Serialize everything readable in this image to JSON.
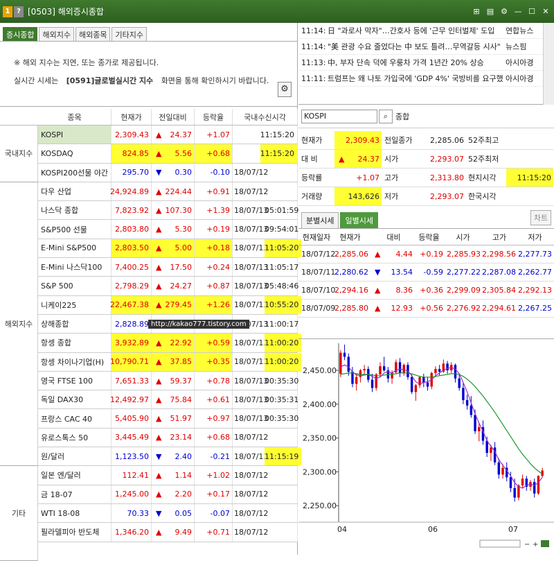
{
  "titlebar": {
    "num1": "1",
    "num2": "?",
    "title": "[0503] 해외증시종합"
  },
  "tabs": [
    "증시종합",
    "해외지수",
    "해외종목",
    "기타지수"
  ],
  "notice": {
    "line1": "※ 해외 지수는 지연, 또는 종가로 제공됩니다.",
    "line2_a": "실시간 시세는",
    "line2_b": "[0591]글로벌실시간 지수",
    "line2_c": "화면을 통해 확인하시기 바랍니다."
  },
  "table": {
    "headers": [
      "종목",
      "현재가",
      "전일대비",
      "등락율",
      "국내수신시각"
    ],
    "groups": [
      {
        "label": "국내지수",
        "rows": 3
      },
      {
        "label": "해외지수",
        "rows": 15
      },
      {
        "label": "기타",
        "rows": 5
      }
    ],
    "rows": [
      {
        "name": "KOSPI",
        "price": "2,309.43",
        "dir": "up",
        "chg": "24.37",
        "rate": "+1.07",
        "date": "",
        "time": "11:15:20",
        "hl": [
          "name"
        ],
        "hltime": false
      },
      {
        "name": "KOSDAQ",
        "price": "824.85",
        "dir": "up",
        "chg": "5.56",
        "rate": "+0.68",
        "date": "",
        "time": "11:15:20",
        "hl": [
          "price",
          "chg",
          "rate"
        ],
        "hltime": true
      },
      {
        "name": "KOSPI200선물 야간",
        "price": "295.70",
        "dir": "down",
        "chg": "0.30",
        "rate": "-0.10",
        "date": "18/07/12",
        "time": "",
        "hl": [],
        "hltime": false
      },
      {
        "name": "다우 산업",
        "price": "24,924.89",
        "dir": "up",
        "chg": "224.44",
        "rate": "+0.91",
        "date": "18/07/12",
        "time": "",
        "hl": [],
        "hltime": false
      },
      {
        "name": "나스닥 종합",
        "price": "7,823.92",
        "dir": "up",
        "chg": "107.30",
        "rate": "+1.39",
        "date": "18/07/13",
        "time": "05:01:59",
        "hl": [],
        "hltime": false
      },
      {
        "name": "S&P500 선물",
        "price": "2,803.80",
        "dir": "up",
        "chg": "5.30",
        "rate": "+0.19",
        "date": "18/07/13",
        "time": "09:54:01",
        "hl": [],
        "hltime": false
      },
      {
        "name": "E-Mini S&P500",
        "price": "2,803.50",
        "dir": "up",
        "chg": "5.00",
        "rate": "+0.18",
        "date": "18/07/13",
        "time": "11:05:20",
        "hl": [
          "price",
          "chg",
          "rate"
        ],
        "hltime": true
      },
      {
        "name": "E-Mini 나스닥100",
        "price": "7,400.25",
        "dir": "up",
        "chg": "17.50",
        "rate": "+0.24",
        "date": "18/07/13",
        "time": "11:05:17",
        "hl": [],
        "hltime": false
      },
      {
        "name": "S&P 500",
        "price": "2,798.29",
        "dir": "up",
        "chg": "24.27",
        "rate": "+0.87",
        "date": "18/07/13",
        "time": "05:48:46",
        "hl": [],
        "hltime": false
      },
      {
        "name": "니케이225",
        "price": "22,467.38",
        "dir": "up",
        "chg": "279.45",
        "rate": "+1.26",
        "date": "18/07/13",
        "time": "10:55:20",
        "hl": [
          "price",
          "chg",
          "rate"
        ],
        "hltime": true
      },
      {
        "name": "상해종합",
        "price": "2,828.89",
        "dir": "down",
        "chg": "8.77",
        "rate": "-0.31",
        "date": "18/07/13",
        "time": "11:00:17",
        "hl": [],
        "hltime": false
      },
      {
        "name": "항셍 종합",
        "price": "3,932.89",
        "dir": "up",
        "chg": "22.92",
        "rate": "+0.59",
        "date": "18/07/13",
        "time": "11:00:20",
        "hl": [
          "price",
          "chg",
          "rate"
        ],
        "hltime": true
      },
      {
        "name": "항셍 차이나기업(H)",
        "price": "10,790.71",
        "dir": "up",
        "chg": "37.85",
        "rate": "+0.35",
        "date": "18/07/13",
        "time": "11:00:20",
        "hl": [
          "price",
          "chg",
          "rate"
        ],
        "hltime": true
      },
      {
        "name": "영국 FTSE 100",
        "price": "7,651.33",
        "dir": "up",
        "chg": "59.37",
        "rate": "+0.78",
        "date": "18/07/13",
        "time": "00:35:30",
        "hl": [],
        "hltime": false
      },
      {
        "name": "독일 DAX30",
        "price": "12,492.97",
        "dir": "up",
        "chg": "75.84",
        "rate": "+0.61",
        "date": "18/07/13",
        "time": "00:35:31",
        "hl": [],
        "hltime": false
      },
      {
        "name": "프랑스 CAC 40",
        "price": "5,405.90",
        "dir": "up",
        "chg": "51.97",
        "rate": "+0.97",
        "date": "18/07/13",
        "time": "00:35:30",
        "hl": [],
        "hltime": false
      },
      {
        "name": "유로스톡스 50",
        "price": "3,445.49",
        "dir": "up",
        "chg": "23.14",
        "rate": "+0.68",
        "date": "18/07/12",
        "time": "",
        "hl": [],
        "hltime": false
      },
      {
        "name": "원/달러",
        "price": "1,123.50",
        "dir": "down",
        "chg": "2.40",
        "rate": "-0.21",
        "date": "18/07/13",
        "time": "11:15:19",
        "hl": [],
        "hltime": true
      },
      {
        "name": "일본 엔/달러",
        "price": "112.41",
        "dir": "up",
        "chg": "1.14",
        "rate": "+1.02",
        "date": "18/07/12",
        "time": "",
        "hl": [],
        "hltime": false
      },
      {
        "name": "금 18-07",
        "price": "1,245.00",
        "dir": "up",
        "chg": "2.20",
        "rate": "+0.17",
        "date": "18/07/12",
        "time": "",
        "hl": [],
        "hltime": false
      },
      {
        "name": "WTI 18-08",
        "price": "70.33",
        "dir": "down",
        "chg": "0.05",
        "rate": "-0.07",
        "date": "18/07/12",
        "time": "",
        "hl": [],
        "hltime": false
      },
      {
        "name": "필라델피아 반도체",
        "price": "1,346.20",
        "dir": "up",
        "chg": "9.49",
        "rate": "+0.71",
        "date": "18/07/12",
        "time": "",
        "hl": [],
        "hltime": false
      }
    ]
  },
  "watermark": "http://kakao777.tistory.com",
  "news": [
    {
      "time": "11:14:",
      "title": "日 \"과로사 막자\"…간호사 등에 '근무 인터벌제' 도입",
      "src": "연합뉴스"
    },
    {
      "time": "11:14:",
      "title": "\"美 관광 수요 줄었다는 中 보도 틀려…무역갈등 시사\"",
      "src": "뉴스핌"
    },
    {
      "time": "11:13:",
      "title": "中, 부자 단속 덕에 우룽차 가격 1년간 20% 상승",
      "src": "아시아경"
    },
    {
      "time": "11:11:",
      "title": "트럼프는 왜 나토 가입국에 'GDP 4%' 국방비를 요구했",
      "src": "아시아경"
    }
  ],
  "search": {
    "value": "KOSPI",
    "label": "종합"
  },
  "quote": {
    "rows": [
      {
        "l1": "현재가",
        "v1": "2,309.43",
        "v1c": "red",
        "v1hl": true,
        "l2": "전일종가",
        "v2": "2,285.06",
        "v2c": "",
        "l3": "52주최고",
        "v3": "",
        "v3hl": false
      },
      {
        "l1": "대 비",
        "v1": "24.37",
        "v1c": "red",
        "v1hl": true,
        "arrow": "▲",
        "l2": "시가",
        "v2": "2,293.07",
        "v2c": "red",
        "l3": "52주최저",
        "v3": "",
        "v3hl": false
      },
      {
        "l1": "등락률",
        "v1": "+1.07",
        "v1c": "red",
        "v1hl": false,
        "l2": "고가",
        "v2": "2,313.80",
        "v2c": "red",
        "l3": "현지시각",
        "v3": "11:15:20",
        "v3hl": true
      },
      {
        "l1": "거래량",
        "v1": "143,626",
        "v1c": "",
        "v1hl": true,
        "l2": "저가",
        "v2": "2,293.07",
        "v2c": "red",
        "l3": "한국시각",
        "v3": "",
        "v3hl": false
      }
    ]
  },
  "tabs2": [
    "분별시세",
    "일별시세"
  ],
  "chart_btn": "차트",
  "daily": {
    "headers": [
      "현재일자",
      "현재가",
      "대비",
      "등락율",
      "시가",
      "고가",
      "저가"
    ],
    "rows": [
      {
        "date": "18/07/12",
        "price": "2,285.06",
        "dir": "up",
        "chg": "4.44",
        "rate": "+0.19",
        "open": "2,285.93",
        "high": "2,298.56",
        "low": "2,277.73",
        "pc": "red",
        "oc": "red",
        "hc": "red",
        "lc": "blue"
      },
      {
        "date": "18/07/11",
        "price": "2,280.62",
        "dir": "down",
        "chg": "13.54",
        "rate": "-0.59",
        "open": "2,277.22",
        "high": "2,287.08",
        "low": "2,262.77",
        "pc": "blue",
        "oc": "blue",
        "hc": "blue",
        "lc": "blue"
      },
      {
        "date": "18/07/10",
        "price": "2,294.16",
        "dir": "up",
        "chg": "8.36",
        "rate": "+0.36",
        "open": "2,299.09",
        "high": "2,305.84",
        "low": "2,292.13",
        "pc": "red",
        "oc": "red",
        "hc": "red",
        "lc": "red"
      },
      {
        "date": "18/07/09",
        "price": "2,285.80",
        "dir": "up",
        "chg": "12.93",
        "rate": "+0.56",
        "open": "2,276.92",
        "high": "2,294.61",
        "low": "2,267.25",
        "pc": "red",
        "oc": "red",
        "hc": "red",
        "lc": "blue"
      }
    ]
  },
  "chart_data": {
    "type": "line",
    "y_ticks": [
      "2,450.00",
      "2,400.00",
      "2,350.00",
      "2,300.00",
      "2,250.00"
    ],
    "x_ticks": [
      "04",
      "06",
      "07"
    ],
    "ylim": [
      2240,
      2490
    ],
    "colors": {
      "up": "#e00000",
      "down": "#0000d0",
      "ma_short": "#9b30c8",
      "ma_long": "#1a9a2a"
    },
    "candles": [
      [
        2445,
        2480,
        2440,
        2476
      ],
      [
        2476,
        2488,
        2465,
        2470
      ],
      [
        2470,
        2475,
        2442,
        2448
      ],
      [
        2448,
        2455,
        2425,
        2430
      ],
      [
        2430,
        2445,
        2420,
        2440
      ],
      [
        2440,
        2452,
        2432,
        2450
      ],
      [
        2450,
        2458,
        2445,
        2452
      ],
      [
        2452,
        2456,
        2432,
        2436
      ],
      [
        2436,
        2445,
        2418,
        2424
      ],
      [
        2424,
        2446,
        2420,
        2444
      ],
      [
        2444,
        2462,
        2440,
        2456
      ],
      [
        2456,
        2470,
        2448,
        2450
      ],
      [
        2450,
        2455,
        2432,
        2438
      ],
      [
        2438,
        2450,
        2430,
        2447
      ],
      [
        2447,
        2466,
        2444,
        2462
      ],
      [
        2462,
        2468,
        2440,
        2446
      ],
      [
        2446,
        2460,
        2442,
        2458
      ],
      [
        2458,
        2462,
        2436,
        2440
      ],
      [
        2440,
        2444,
        2415,
        2418
      ],
      [
        2418,
        2430,
        2405,
        2428
      ],
      [
        2428,
        2442,
        2424,
        2440
      ],
      [
        2440,
        2445,
        2425,
        2432
      ],
      [
        2432,
        2440,
        2420,
        2426
      ],
      [
        2426,
        2448,
        2422,
        2446
      ],
      [
        2446,
        2456,
        2440,
        2452
      ],
      [
        2452,
        2458,
        2442,
        2448
      ],
      [
        2448,
        2466,
        2446,
        2460
      ],
      [
        2460,
        2464,
        2445,
        2450
      ],
      [
        2450,
        2462,
        2446,
        2458
      ],
      [
        2458,
        2460,
        2432,
        2438
      ],
      [
        2438,
        2444,
        2420,
        2424
      ],
      [
        2424,
        2432,
        2400,
        2406
      ],
      [
        2406,
        2414,
        2392,
        2398
      ],
      [
        2398,
        2412,
        2380,
        2384
      ],
      [
        2384,
        2392,
        2356,
        2360
      ],
      [
        2360,
        2372,
        2345,
        2366
      ],
      [
        2366,
        2376,
        2340,
        2346
      ],
      [
        2346,
        2352,
        2322,
        2328
      ],
      [
        2328,
        2340,
        2316,
        2336
      ],
      [
        2336,
        2344,
        2310,
        2314
      ],
      [
        2314,
        2320,
        2290,
        2296
      ],
      [
        2296,
        2312,
        2290,
        2306
      ],
      [
        2306,
        2314,
        2286,
        2292
      ],
      [
        2292,
        2300,
        2270,
        2276
      ],
      [
        2276,
        2290,
        2256,
        2262
      ],
      [
        2262,
        2282,
        2258,
        2280
      ],
      [
        2280,
        2296,
        2276,
        2290
      ],
      [
        2290,
        2294,
        2272,
        2278
      ],
      [
        2278,
        2288,
        2272,
        2285
      ],
      [
        2285,
        2290,
        2262,
        2268
      ],
      [
        2268,
        2295,
        2266,
        2294
      ],
      [
        2294,
        2306,
        2292,
        2302
      ]
    ],
    "ma_short": [
      2455,
      2458,
      2455,
      2448,
      2443,
      2442,
      2443,
      2444,
      2441,
      2438,
      2440,
      2446,
      2448,
      2446,
      2450,
      2452,
      2451,
      2449,
      2442,
      2433,
      2430,
      2432,
      2433,
      2436,
      2442,
      2446,
      2450,
      2453,
      2454,
      2452,
      2445,
      2432,
      2418,
      2402,
      2386,
      2372,
      2360,
      2346,
      2338,
      2330,
      2318,
      2310,
      2302,
      2294,
      2284,
      2278,
      2276,
      2280,
      2282,
      2280,
      2284,
      2292
    ],
    "ma_long": [
      2444,
      2445,
      2446,
      2446,
      2445,
      2444,
      2444,
      2444,
      2443,
      2442,
      2442,
      2443,
      2444,
      2444,
      2445,
      2446,
      2446,
      2446,
      2445,
      2443,
      2441,
      2440,
      2440,
      2440,
      2441,
      2442,
      2443,
      2444,
      2445,
      2445,
      2444,
      2441,
      2437,
      2432,
      2426,
      2419,
      2412,
      2404,
      2396,
      2388,
      2379,
      2370,
      2361,
      2352,
      2343,
      2334,
      2326,
      2319,
      2312,
      2306,
      2301,
      2297
    ]
  }
}
